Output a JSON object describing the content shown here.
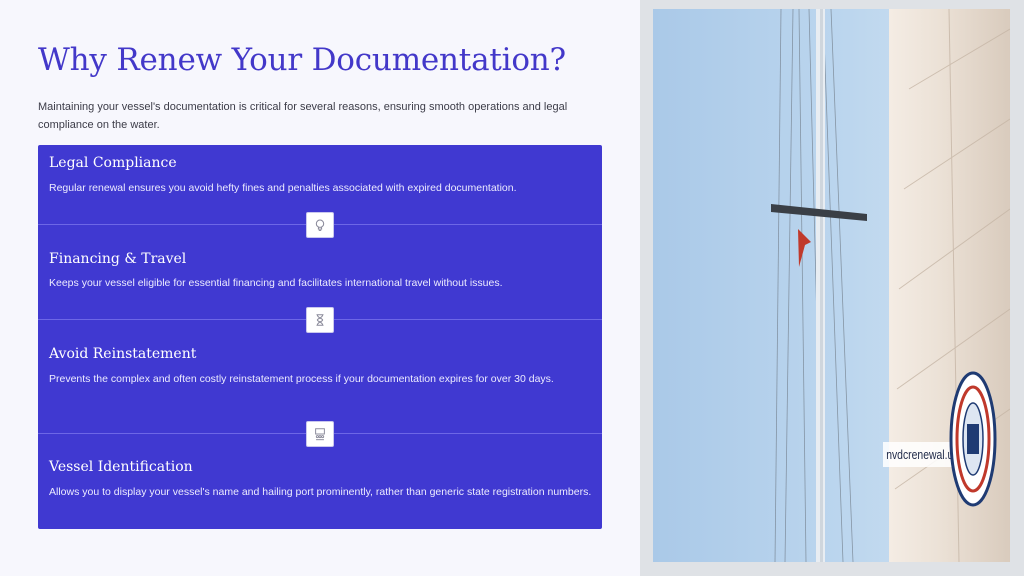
{
  "slide": {
    "title": "Why Renew Your Documentation?",
    "intro": "Maintaining your vessel's documentation is critical for several reasons, ensuring smooth operations and legal compliance on the water."
  },
  "reasons": [
    {
      "title": "Legal Compliance",
      "desc": "Regular renewal ensures you avoid hefty fines and penalties associated with expired documentation.",
      "icon": "lightbulb-icon"
    },
    {
      "title": "Financing & Travel",
      "desc": "Keeps your vessel eligible for essential financing and facilitates international travel without issues.",
      "icon": "hourglass-icon"
    },
    {
      "title": "Avoid Reinstatement",
      "desc": "Prevents the complex and often costly reinstatement process if your documentation expires for over 30 days.",
      "icon": "presentation-icon"
    },
    {
      "title": "Vessel Identification",
      "desc": "Allows you to display your vessel's name and hailing port prominently, rather than generic state registration numbers."
    }
  ],
  "photo": {
    "watermark_text": "nvdcrenewal.us",
    "subject": "sailboat-mast-photo"
  },
  "colors": {
    "accent": "#4338c9",
    "panel": "#4039d1",
    "background": "#f7f7fd"
  }
}
